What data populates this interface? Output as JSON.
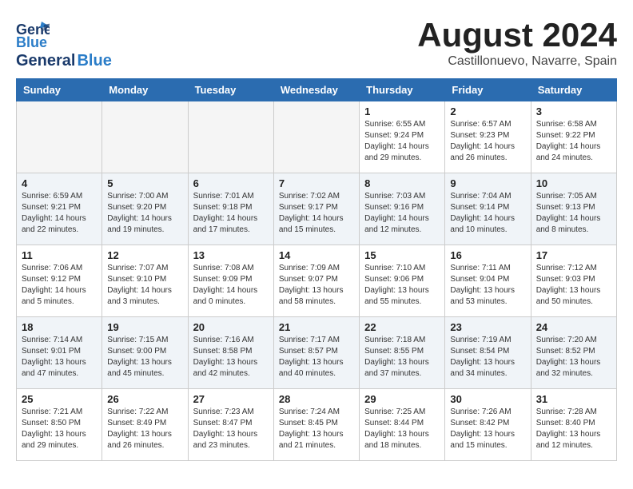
{
  "header": {
    "logo_line1": "General",
    "logo_line2": "Blue",
    "month_year": "August 2024",
    "location": "Castillonuevo, Navarre, Spain"
  },
  "weekdays": [
    "Sunday",
    "Monday",
    "Tuesday",
    "Wednesday",
    "Thursday",
    "Friday",
    "Saturday"
  ],
  "weeks": [
    [
      {
        "day": "",
        "info": ""
      },
      {
        "day": "",
        "info": ""
      },
      {
        "day": "",
        "info": ""
      },
      {
        "day": "",
        "info": ""
      },
      {
        "day": "1",
        "info": "Sunrise: 6:55 AM\nSunset: 9:24 PM\nDaylight: 14 hours\nand 29 minutes."
      },
      {
        "day": "2",
        "info": "Sunrise: 6:57 AM\nSunset: 9:23 PM\nDaylight: 14 hours\nand 26 minutes."
      },
      {
        "day": "3",
        "info": "Sunrise: 6:58 AM\nSunset: 9:22 PM\nDaylight: 14 hours\nand 24 minutes."
      }
    ],
    [
      {
        "day": "4",
        "info": "Sunrise: 6:59 AM\nSunset: 9:21 PM\nDaylight: 14 hours\nand 22 minutes."
      },
      {
        "day": "5",
        "info": "Sunrise: 7:00 AM\nSunset: 9:20 PM\nDaylight: 14 hours\nand 19 minutes."
      },
      {
        "day": "6",
        "info": "Sunrise: 7:01 AM\nSunset: 9:18 PM\nDaylight: 14 hours\nand 17 minutes."
      },
      {
        "day": "7",
        "info": "Sunrise: 7:02 AM\nSunset: 9:17 PM\nDaylight: 14 hours\nand 15 minutes."
      },
      {
        "day": "8",
        "info": "Sunrise: 7:03 AM\nSunset: 9:16 PM\nDaylight: 14 hours\nand 12 minutes."
      },
      {
        "day": "9",
        "info": "Sunrise: 7:04 AM\nSunset: 9:14 PM\nDaylight: 14 hours\nand 10 minutes."
      },
      {
        "day": "10",
        "info": "Sunrise: 7:05 AM\nSunset: 9:13 PM\nDaylight: 14 hours\nand 8 minutes."
      }
    ],
    [
      {
        "day": "11",
        "info": "Sunrise: 7:06 AM\nSunset: 9:12 PM\nDaylight: 14 hours\nand 5 minutes."
      },
      {
        "day": "12",
        "info": "Sunrise: 7:07 AM\nSunset: 9:10 PM\nDaylight: 14 hours\nand 3 minutes."
      },
      {
        "day": "13",
        "info": "Sunrise: 7:08 AM\nSunset: 9:09 PM\nDaylight: 14 hours\nand 0 minutes."
      },
      {
        "day": "14",
        "info": "Sunrise: 7:09 AM\nSunset: 9:07 PM\nDaylight: 13 hours\nand 58 minutes."
      },
      {
        "day": "15",
        "info": "Sunrise: 7:10 AM\nSunset: 9:06 PM\nDaylight: 13 hours\nand 55 minutes."
      },
      {
        "day": "16",
        "info": "Sunrise: 7:11 AM\nSunset: 9:04 PM\nDaylight: 13 hours\nand 53 minutes."
      },
      {
        "day": "17",
        "info": "Sunrise: 7:12 AM\nSunset: 9:03 PM\nDaylight: 13 hours\nand 50 minutes."
      }
    ],
    [
      {
        "day": "18",
        "info": "Sunrise: 7:14 AM\nSunset: 9:01 PM\nDaylight: 13 hours\nand 47 minutes."
      },
      {
        "day": "19",
        "info": "Sunrise: 7:15 AM\nSunset: 9:00 PM\nDaylight: 13 hours\nand 45 minutes."
      },
      {
        "day": "20",
        "info": "Sunrise: 7:16 AM\nSunset: 8:58 PM\nDaylight: 13 hours\nand 42 minutes."
      },
      {
        "day": "21",
        "info": "Sunrise: 7:17 AM\nSunset: 8:57 PM\nDaylight: 13 hours\nand 40 minutes."
      },
      {
        "day": "22",
        "info": "Sunrise: 7:18 AM\nSunset: 8:55 PM\nDaylight: 13 hours\nand 37 minutes."
      },
      {
        "day": "23",
        "info": "Sunrise: 7:19 AM\nSunset: 8:54 PM\nDaylight: 13 hours\nand 34 minutes."
      },
      {
        "day": "24",
        "info": "Sunrise: 7:20 AM\nSunset: 8:52 PM\nDaylight: 13 hours\nand 32 minutes."
      }
    ],
    [
      {
        "day": "25",
        "info": "Sunrise: 7:21 AM\nSunset: 8:50 PM\nDaylight: 13 hours\nand 29 minutes."
      },
      {
        "day": "26",
        "info": "Sunrise: 7:22 AM\nSunset: 8:49 PM\nDaylight: 13 hours\nand 26 minutes."
      },
      {
        "day": "27",
        "info": "Sunrise: 7:23 AM\nSunset: 8:47 PM\nDaylight: 13 hours\nand 23 minutes."
      },
      {
        "day": "28",
        "info": "Sunrise: 7:24 AM\nSunset: 8:45 PM\nDaylight: 13 hours\nand 21 minutes."
      },
      {
        "day": "29",
        "info": "Sunrise: 7:25 AM\nSunset: 8:44 PM\nDaylight: 13 hours\nand 18 minutes."
      },
      {
        "day": "30",
        "info": "Sunrise: 7:26 AM\nSunset: 8:42 PM\nDaylight: 13 hours\nand 15 minutes."
      },
      {
        "day": "31",
        "info": "Sunrise: 7:28 AM\nSunset: 8:40 PM\nDaylight: 13 hours\nand 12 minutes."
      }
    ]
  ]
}
